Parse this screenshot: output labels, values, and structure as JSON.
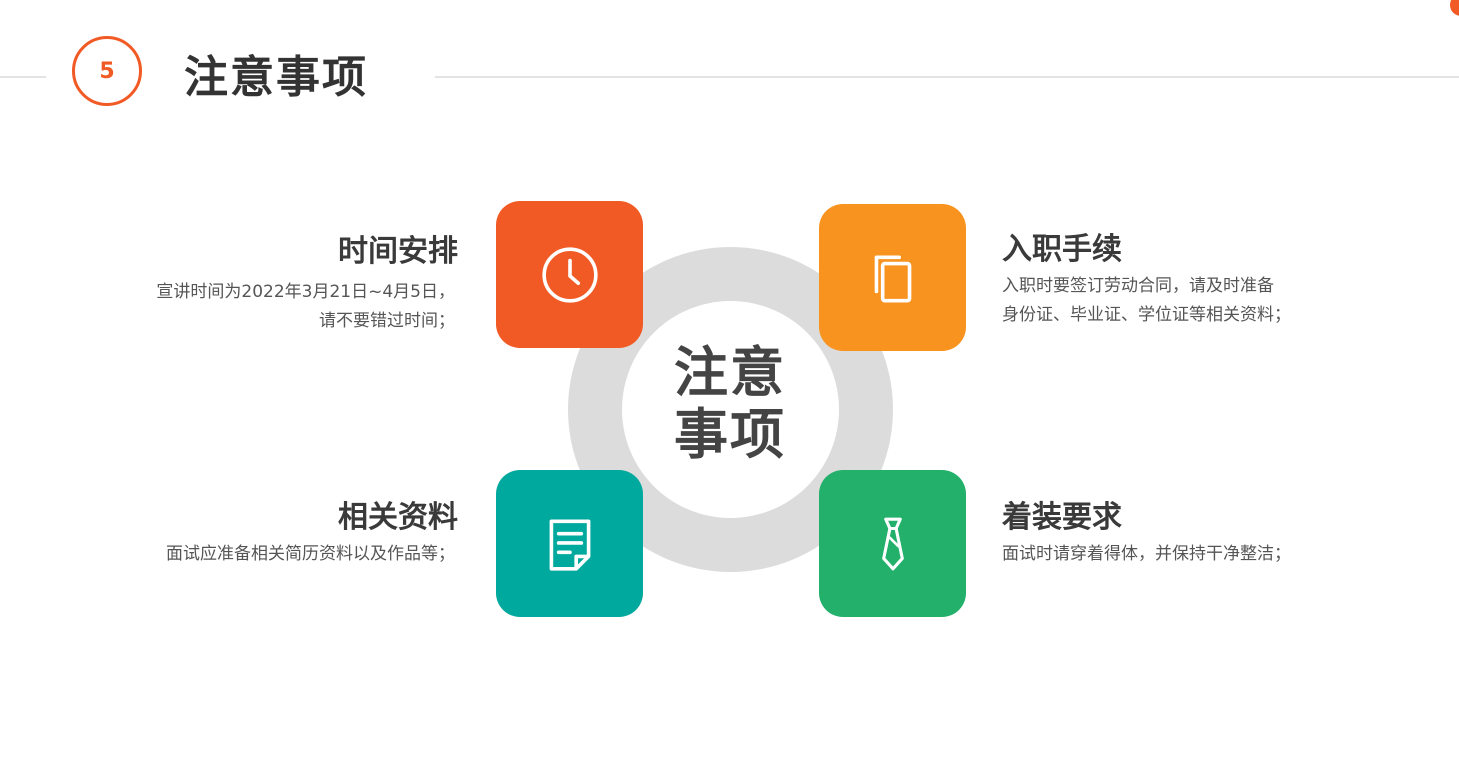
{
  "header": {
    "number": "5",
    "title": "注意事项",
    "accent_color": "#f15a24"
  },
  "center": {
    "line1": "注意",
    "line2": "事项"
  },
  "items": [
    {
      "title": "时间安排",
      "desc_lines": [
        "宣讲时间为2022年3月21日~4月5日，",
        "请不要错过时间；"
      ],
      "icon": "clock-icon",
      "color": "#f15a24"
    },
    {
      "title": "入职手续",
      "desc_lines": [
        "入职时要签订劳动合同，请及时准备",
        "身份证、毕业证、学位证等相关资料；"
      ],
      "icon": "copy-documents-icon",
      "color": "#f7931e"
    },
    {
      "title": "相关资料",
      "desc_lines": [
        "面试应准备相关简历资料以及作品等；"
      ],
      "icon": "note-document-icon",
      "color": "#00a99d"
    },
    {
      "title": "着装要求",
      "desc_lines": [
        "面试时请穿着得体，并保持干净整洁；"
      ],
      "icon": "necktie-icon",
      "color": "#22b06a"
    }
  ],
  "ring_color": "#dcdcdc"
}
